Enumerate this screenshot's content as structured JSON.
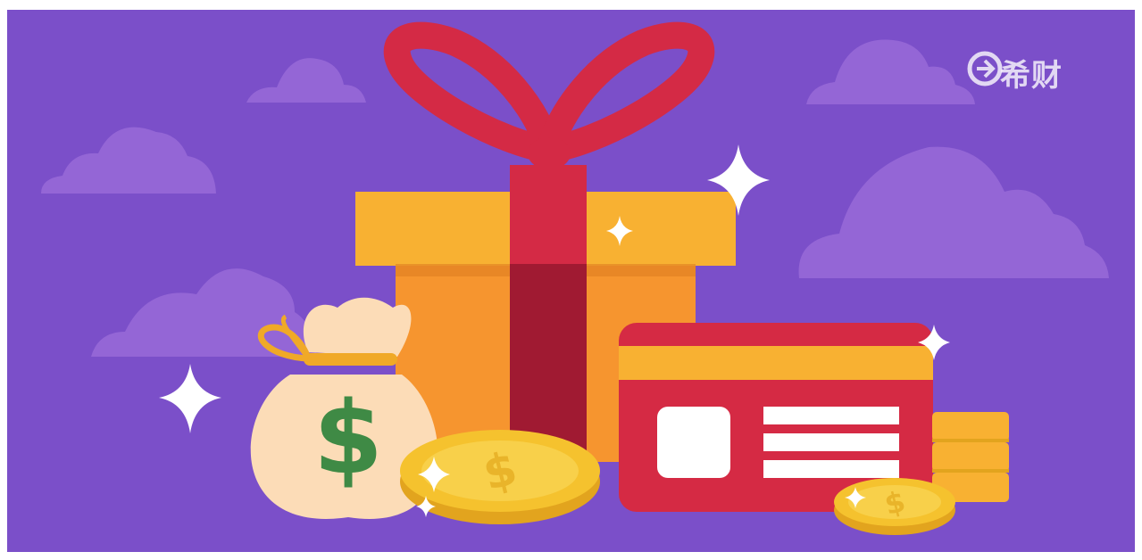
{
  "watermark": {
    "text": "希财",
    "icon": "brand-logo-icon"
  },
  "money_bag": {
    "symbol": "$"
  },
  "coins": {
    "symbol": "$"
  },
  "colors": {
    "background": "#7b4fc9",
    "cloud": "#9466d6",
    "ribbon": "#d42a45",
    "ribbon_dark": "#a01a32",
    "gift_box": "#f6952f",
    "gift_lid": "#f8b132",
    "bag": "#fcdcb7",
    "dollar_green": "#3f8a45",
    "card": "#d52a44",
    "card_stripe": "#f8b132",
    "coin_gold": "#f5c22e",
    "coin_edge": "#e2a41e",
    "sparkle": "#ffffff"
  }
}
